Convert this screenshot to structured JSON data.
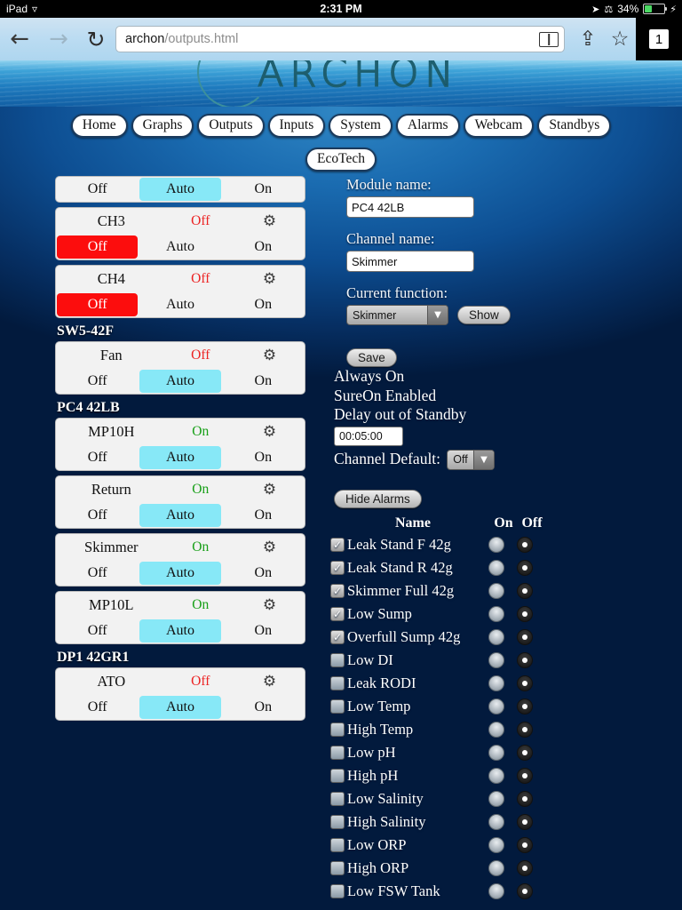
{
  "status_bar": {
    "device": "iPad",
    "wifi_icon": "wifi-icon",
    "time": "2:31 PM",
    "location_icon": "location-arrow-icon",
    "bluetooth_icon": "bluetooth-icon",
    "battery_percent": "34%",
    "charging_icon": "lightning-bolt-icon"
  },
  "browser": {
    "back_icon": "back-arrow-icon",
    "forward_icon": "forward-arrow-icon",
    "reload_icon": "reload-icon",
    "url_host": "archon",
    "url_path": "/outputs.html",
    "reader_icon": "reader-view-icon",
    "share_icon": "share-icon",
    "bookmark_icon": "bookmark-star-icon",
    "tab_count": "1"
  },
  "banner": {
    "logo_text": "ARCHON"
  },
  "nav": {
    "primary": [
      {
        "label": "Home"
      },
      {
        "label": "Graphs"
      },
      {
        "label": "Outputs"
      },
      {
        "label": "Inputs"
      },
      {
        "label": "System"
      },
      {
        "label": "Alarms"
      },
      {
        "label": "Webcam"
      },
      {
        "label": "Standbys"
      }
    ],
    "secondary": [
      {
        "label": "EcoTech"
      }
    ]
  },
  "outputs": {
    "mode_labels": {
      "off": "Off",
      "auto": "Auto",
      "on": "On"
    },
    "gear_icon": "gear-icon",
    "items": [
      {
        "kind": "card",
        "name": "",
        "state": "",
        "state_class": "",
        "mode": "auto",
        "partial_top": true
      },
      {
        "kind": "card",
        "name": "CH3",
        "state": "Off",
        "state_class": "off",
        "mode": "off"
      },
      {
        "kind": "card",
        "name": "CH4",
        "state": "Off",
        "state_class": "off",
        "mode": "off"
      },
      {
        "kind": "group",
        "label": "SW5-42F"
      },
      {
        "kind": "card",
        "name": "Fan",
        "state": "Off",
        "state_class": "off",
        "mode": "auto"
      },
      {
        "kind": "group",
        "label": "PC4 42LB"
      },
      {
        "kind": "card",
        "name": "MP10H",
        "state": "On",
        "state_class": "on",
        "mode": "auto"
      },
      {
        "kind": "card",
        "name": "Return",
        "state": "On",
        "state_class": "on",
        "mode": "auto"
      },
      {
        "kind": "card",
        "name": "Skimmer",
        "state": "On",
        "state_class": "on",
        "mode": "auto"
      },
      {
        "kind": "card",
        "name": "MP10L",
        "state": "On",
        "state_class": "on",
        "mode": "auto"
      },
      {
        "kind": "group",
        "label": "DP1 42GR1"
      },
      {
        "kind": "card",
        "name": "ATO",
        "state": "Off",
        "state_class": "off",
        "mode": "auto"
      }
    ]
  },
  "detail": {
    "module_name_label": "Module name:",
    "module_name_value": "PC4 42LB",
    "channel_name_label": "Channel name:",
    "channel_name_value": "Skimmer",
    "current_function_label": "Current function:",
    "current_function_value": "Skimmer",
    "show_button": "Show",
    "save_button": "Save",
    "always_on": "Always On",
    "sure_on": "SureOn Enabled",
    "delay_label": "Delay out of Standby",
    "delay_value": "00:05:00",
    "channel_default_label": "Channel Default:",
    "channel_default_value": "Off",
    "hide_alarms_button": "Hide Alarms",
    "dropdown_arrow_icon": "chevron-down-icon"
  },
  "alarms": {
    "header": {
      "name": "Name",
      "on": "On",
      "off": "Off"
    },
    "check_glyph": "✓",
    "rows": [
      {
        "label": "Leak Stand F 42g",
        "checked": true,
        "selected": "off"
      },
      {
        "label": "Leak Stand R 42g",
        "checked": true,
        "selected": "off"
      },
      {
        "label": "Skimmer Full 42g",
        "checked": true,
        "selected": "off"
      },
      {
        "label": "Low Sump",
        "checked": true,
        "selected": "off"
      },
      {
        "label": "Overfull Sump 42g",
        "checked": true,
        "selected": "off"
      },
      {
        "label": "Low DI",
        "checked": false,
        "selected": "off"
      },
      {
        "label": "Leak RODI",
        "checked": false,
        "selected": "off"
      },
      {
        "label": "Low Temp",
        "checked": false,
        "selected": "off"
      },
      {
        "label": "High Temp",
        "checked": false,
        "selected": "off"
      },
      {
        "label": "Low pH",
        "checked": false,
        "selected": "off"
      },
      {
        "label": "High pH",
        "checked": false,
        "selected": "off"
      },
      {
        "label": "Low Salinity",
        "checked": false,
        "selected": "off"
      },
      {
        "label": "High Salinity",
        "checked": false,
        "selected": "off"
      },
      {
        "label": "Low ORP",
        "checked": false,
        "selected": "off"
      },
      {
        "label": "High ORP",
        "checked": false,
        "selected": "off"
      },
      {
        "label": "Low FSW Tank",
        "checked": false,
        "selected": "off"
      }
    ]
  },
  "colors": {
    "auto_selected": "#87e8f7",
    "off_selected": "#fc0d0d",
    "state_on": "#19a019",
    "state_off": "#ec2222"
  }
}
